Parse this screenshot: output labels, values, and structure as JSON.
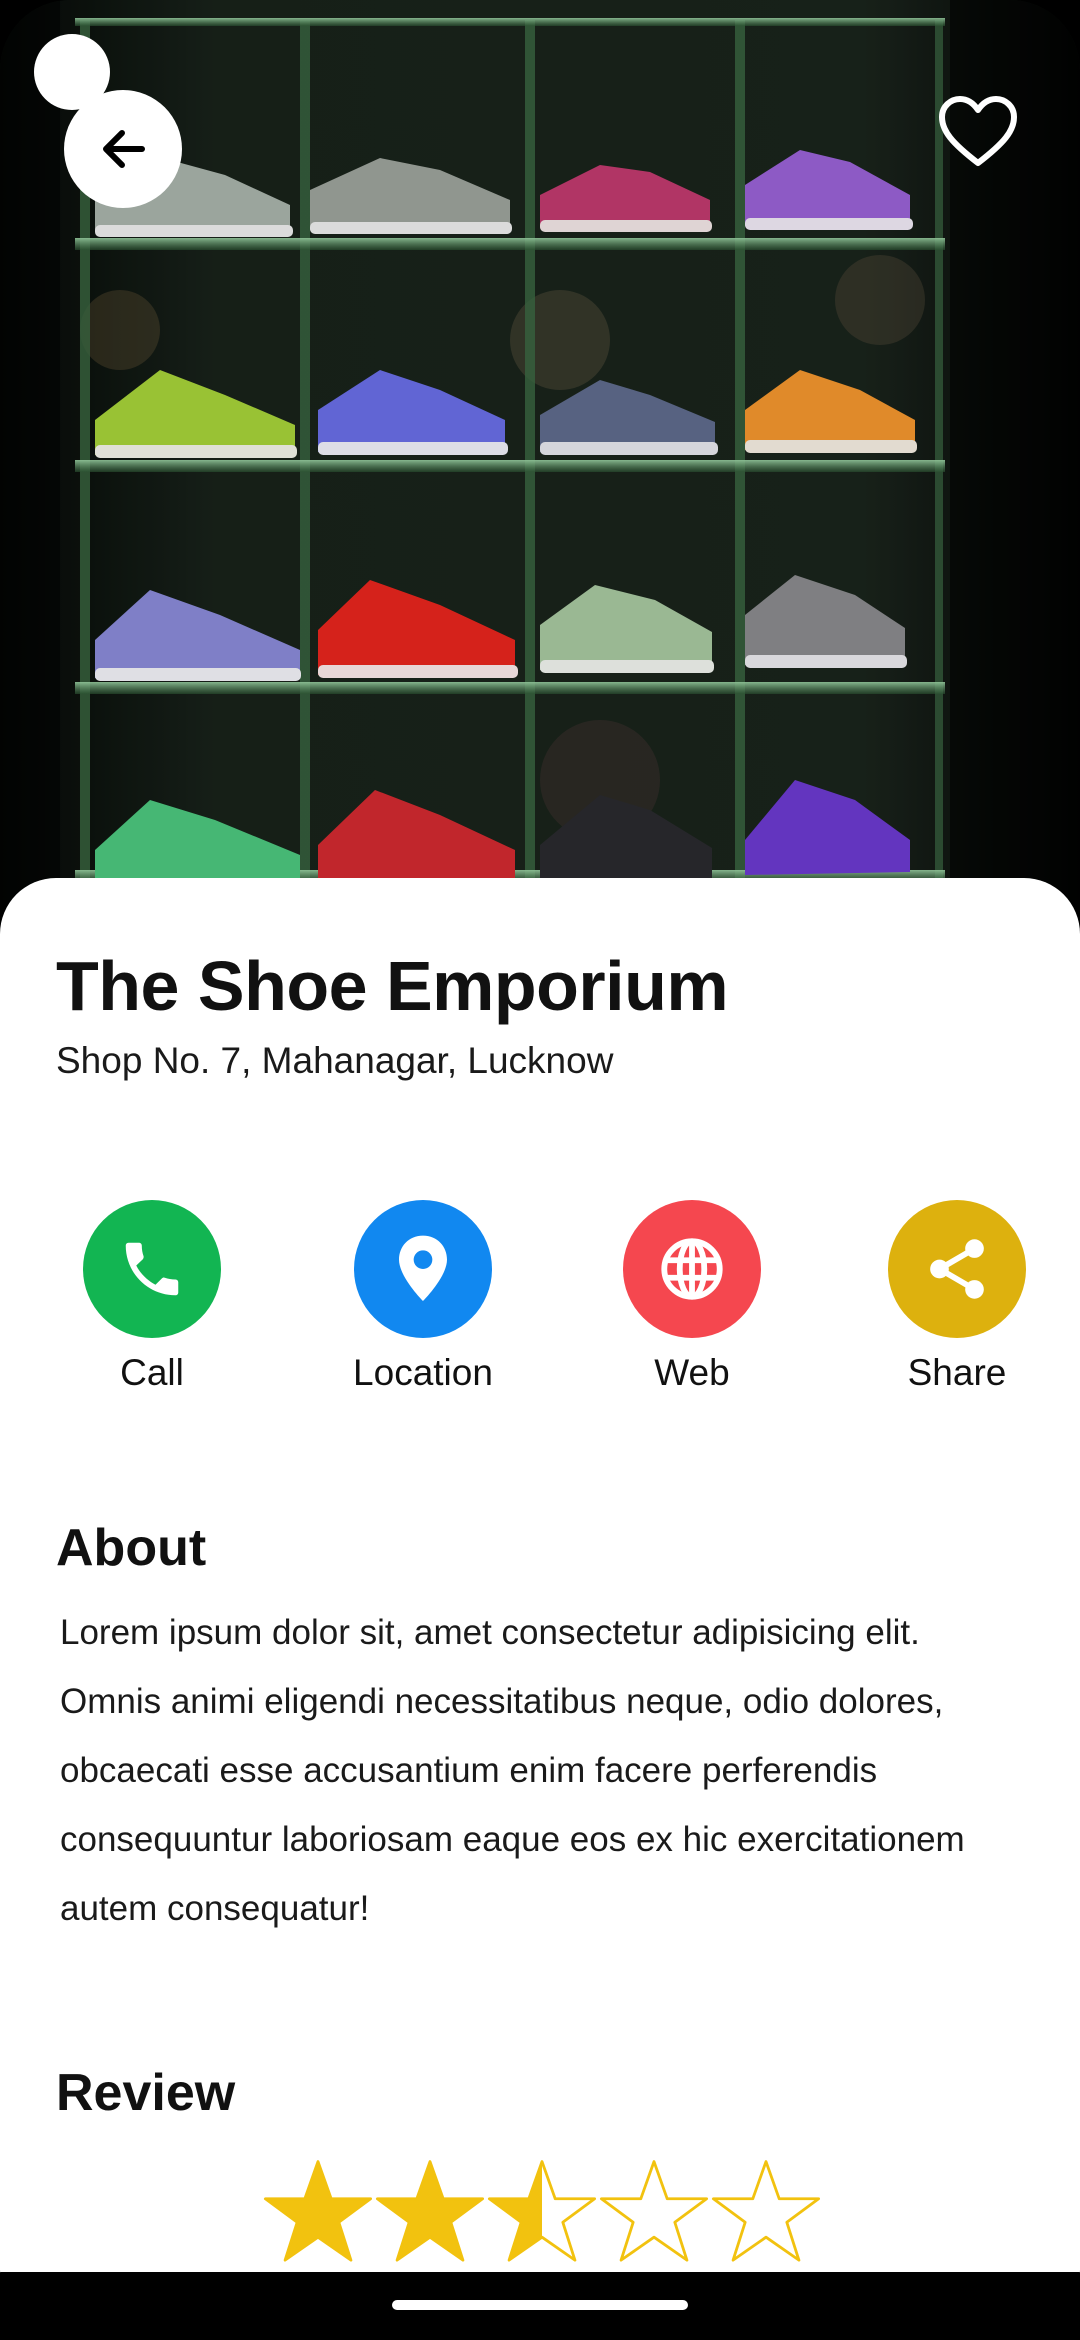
{
  "shop": {
    "name": "The Shoe Emporium",
    "address": "Shop No. 7, Mahanagar, Lucknow"
  },
  "hero": {
    "image_subject": "display shelves of colorful canvas high-top sneakers",
    "back_icon": "arrow-left-icon",
    "favorite_icon": "heart-outline-icon"
  },
  "actions": [
    {
      "label": "Call",
      "icon": "phone-icon",
      "color": "#12B552"
    },
    {
      "label": "Location",
      "icon": "map-pin-icon",
      "color": "#1188F0"
    },
    {
      "label": "Web",
      "icon": "globe-icon",
      "color": "#F5474F"
    },
    {
      "label": "Share",
      "icon": "share-icon",
      "color": "#DDB10E"
    }
  ],
  "about": {
    "title": "About",
    "text": "Lorem ipsum dolor sit, amet consectetur adipisicing elit. Omnis animi eligendi necessitatibus neque, odio dolores, obcaecati esse accusantium enim facere perferendis consequuntur laboriosam eaque eos ex hic exercitationem autem consequatur!"
  },
  "review": {
    "title": "Review",
    "rating": 2.5,
    "max_rating": 5,
    "star_color": "#F2C20F"
  }
}
